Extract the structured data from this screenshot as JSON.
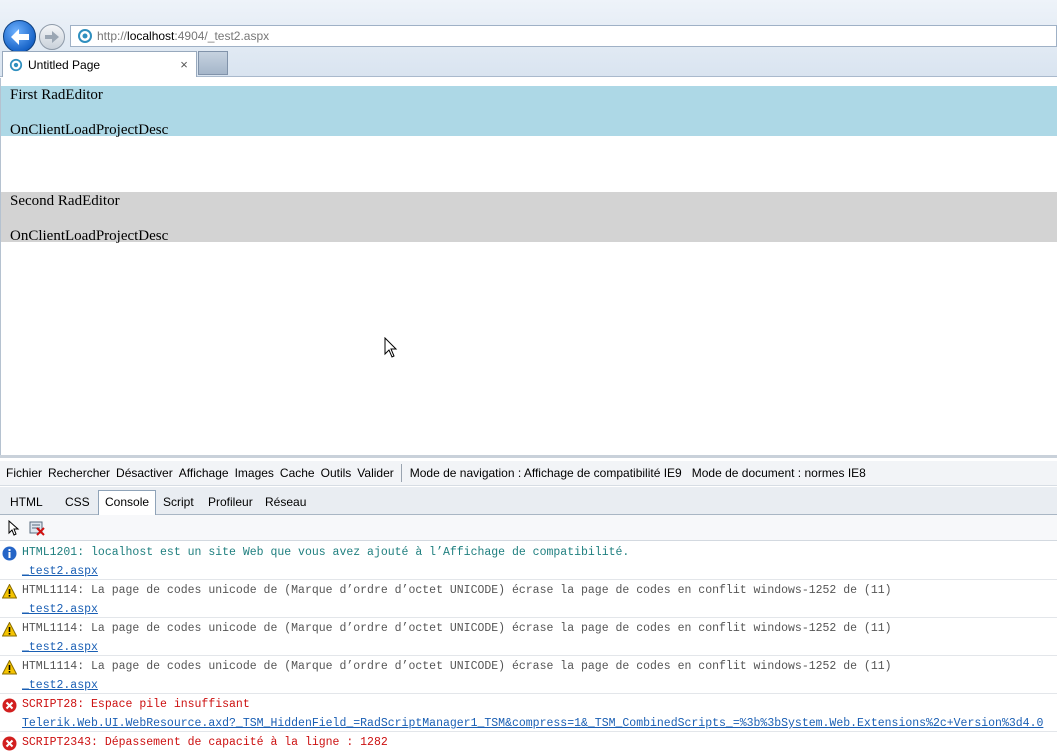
{
  "browser": {
    "url_prefix": "http://",
    "url_host": "localhost",
    "url_rest": ":4904/_test2.aspx",
    "tab_title": "Untitled Page",
    "tab_close": "×"
  },
  "page": {
    "editor1": {
      "line1": "First RadEditor",
      "line2": "OnClientLoadProjectDesc",
      "bg": "#add8e6"
    },
    "editor2": {
      "line1": "Second RadEditor",
      "line2": "OnClientLoadProjectDesc",
      "bg": "#d3d3d3"
    }
  },
  "devtools": {
    "menu": [
      "Fichier",
      "Rechercher",
      "Désactiver",
      "Affichage",
      "Images",
      "Cache",
      "Outils",
      "Valider"
    ],
    "browser_mode": "Mode de navigation : Affichage de compatibilité IE9",
    "document_mode": "Mode de document : normes IE8",
    "tabs": [
      "HTML",
      "CSS",
      "Console",
      "Script",
      "Profileur",
      "Réseau"
    ],
    "active_tab": "Console",
    "messages": [
      {
        "type": "info",
        "text": "HTML1201: localhost est un site Web que vous avez ajouté à l’Affichage de compatibilité.",
        "link": "_test2.aspx"
      },
      {
        "type": "warning",
        "text": "HTML1114: La page de codes unicode de (Marque d’ordre d’octet UNICODE) écrase la page de codes en conflit windows-1252 de (11)",
        "link": "_test2.aspx"
      },
      {
        "type": "warning",
        "text": "HTML1114: La page de codes unicode de (Marque d’ordre d’octet UNICODE) écrase la page de codes en conflit windows-1252 de (11)",
        "link": "_test2.aspx"
      },
      {
        "type": "warning",
        "text": "HTML1114: La page de codes unicode de (Marque d’ordre d’octet UNICODE) écrase la page de codes en conflit windows-1252 de (11)",
        "link": "_test2.aspx"
      },
      {
        "type": "error",
        "text": "SCRIPT28: Espace pile insuffisant",
        "link": "Telerik.Web.UI.WebResource.axd?_TSM_HiddenField_=RadScriptManager1_TSM&compress=1&_TSM_CombinedScripts_=%3b%3bSystem.Web.Extensions%2c+Version%3d4.0"
      },
      {
        "type": "error",
        "text": "SCRIPT2343: Dépassement de capacité à la ligne : 1282",
        "link": ""
      }
    ]
  },
  "colors": {
    "info": "#1f7f7f",
    "warning": "#555555",
    "error": "#cc1010",
    "link": "#1a5fb4"
  }
}
